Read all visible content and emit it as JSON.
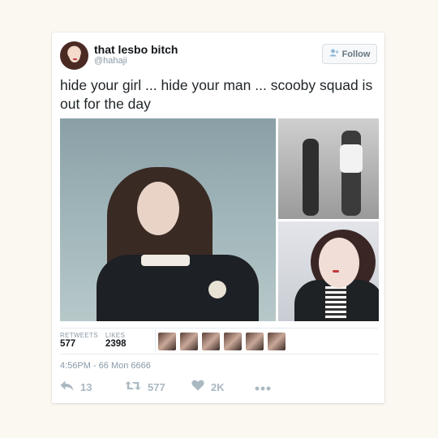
{
  "tweet": {
    "display_name": "that lesbo bitch",
    "handle": "@hahaji",
    "follow_label": "Follow",
    "follow_icon": "add-user-icon",
    "text": "hide your girl ... hide your man ... scooby squad is out for the day",
    "stats": {
      "retweets_label": "RETWEETS",
      "retweets_value": "577",
      "likes_label": "LIKES",
      "likes_value": "2398",
      "liker_avatar_count": 6
    },
    "timestamp": "4:56PM - 66 Mon 6666",
    "actions": {
      "reply_count": "13",
      "retweet_count": "577",
      "like_count": "2K"
    }
  },
  "colors": {
    "page_background": "#fbf7f1",
    "card_background": "#ffffff",
    "muted_text": "#8899a6",
    "primary_text": "#14171a"
  }
}
